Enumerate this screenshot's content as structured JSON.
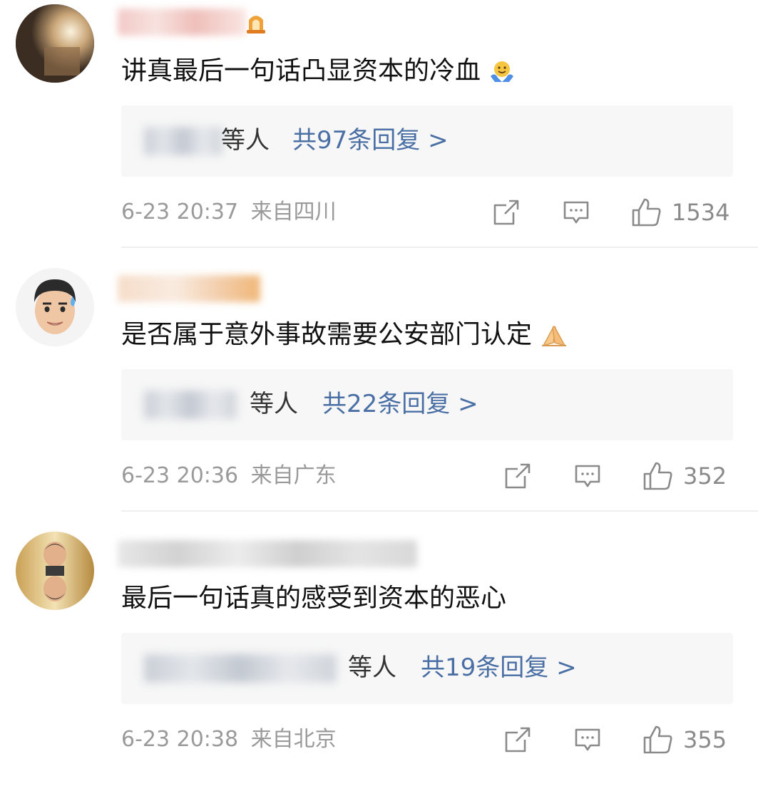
{
  "comments": [
    {
      "text": "讲真最后一句话凸显资本的冷血",
      "emoji_icon": "shrug-emoji-icon",
      "reply_others": "等人",
      "reply_count": "共97条回复 >",
      "timestamp": "6-23 20:37",
      "location": "来自四川",
      "likes": "1534"
    },
    {
      "text": "是否属于意外事故需要公安部门认定",
      "emoji_icon": "praying-hands-emoji-icon",
      "reply_others": "等人",
      "reply_count": "共22条回复 >",
      "timestamp": "6-23 20:36",
      "location": "来自广东",
      "likes": "352"
    },
    {
      "text": "最后一句话真的感受到资本的恶心",
      "emoji_icon": "",
      "reply_others": "等人",
      "reply_count": "共19条回复 >",
      "timestamp": "6-23 20:38",
      "location": "来自北京",
      "likes": "355"
    }
  ],
  "icons": {
    "repost": "repost-icon",
    "comment": "comment-icon",
    "like": "thumbs-up-icon"
  },
  "colors": {
    "reply_link": "#4a6fa5",
    "meta_text": "#9a9a9a",
    "reply_box_bg": "#f7f7f7"
  }
}
